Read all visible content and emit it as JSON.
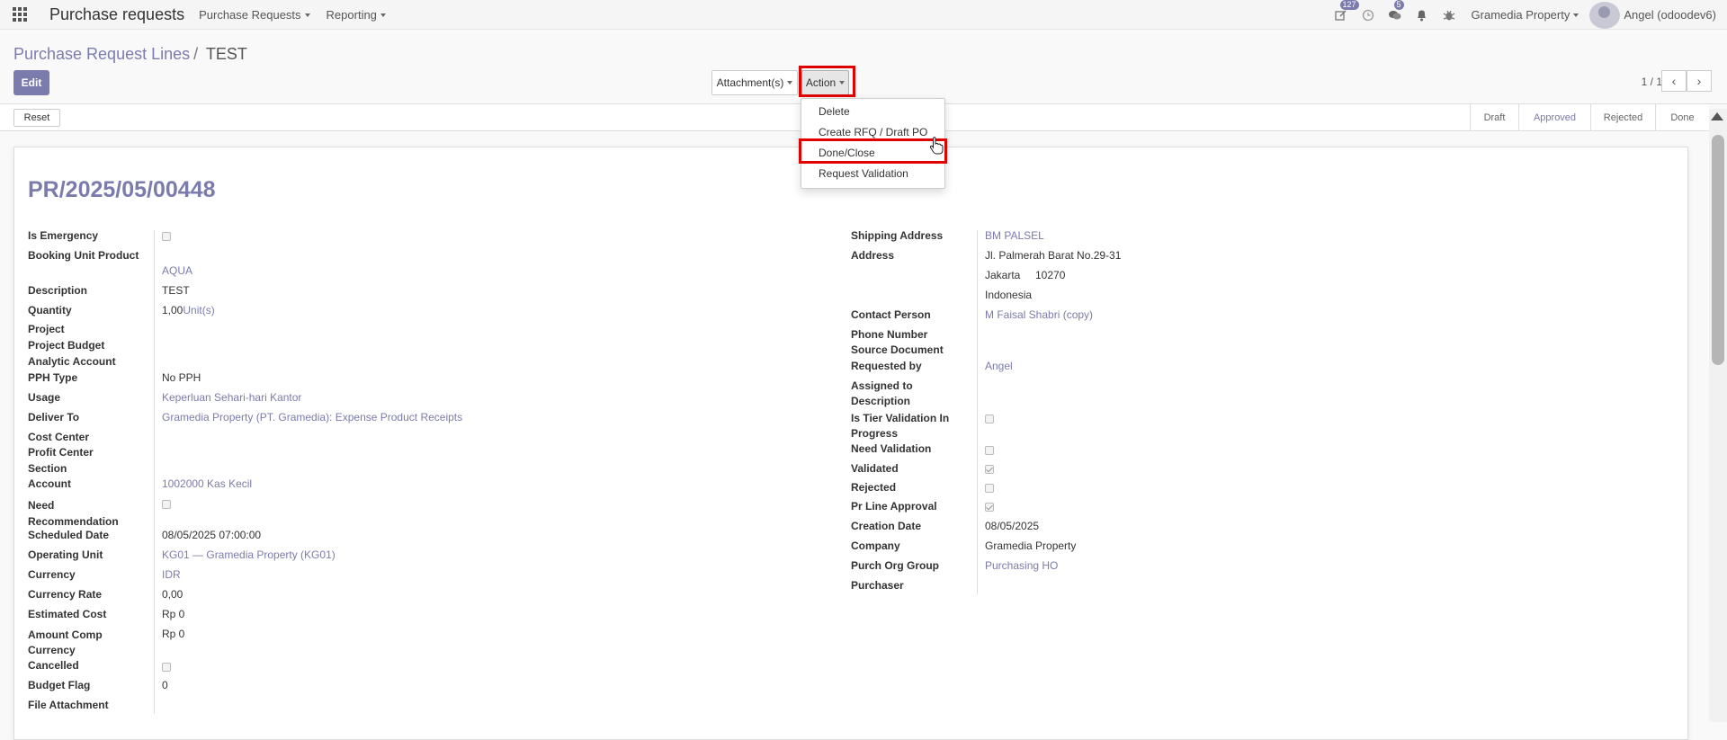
{
  "navbar": {
    "app_title": "Purchase requests",
    "menus": [
      "Purchase Requests",
      "Reporting"
    ],
    "activity_badge": "127",
    "chat_badge": "5",
    "company": "Gramedia Property",
    "user": "Angel (odoodev6)"
  },
  "breadcrumb": {
    "parent": "Purchase Request Lines",
    "current": "TEST"
  },
  "toolbar": {
    "edit": "Edit",
    "attachments": "Attachment(s)",
    "action": "Action",
    "pager": "1 / 1"
  },
  "statusbar": {
    "reset": "Reset",
    "stages": [
      "Draft",
      "Approved",
      "Rejected",
      "Done"
    ]
  },
  "action_menu": [
    "Delete",
    "Create RFQ / Draft PO",
    "Done/Close",
    "Request Validation"
  ],
  "record": {
    "name": "PR/2025/05/00448",
    "left": {
      "is_emergency": "Is Emergency",
      "booking_unit_product": "Booking Unit Product",
      "booking_unit_product_value": "AQUA",
      "description": "Description",
      "description_value": "TEST",
      "quantity": "Quantity",
      "quantity_value": "1,00",
      "quantity_uom": "Unit(s)",
      "project": "Project",
      "project_budget": "Project Budget",
      "analytic_account": "Analytic Account",
      "pph_type": "PPH Type",
      "pph_type_value": "No PPH",
      "usage": "Usage",
      "usage_value": "Keperluan Sehari-hari Kantor",
      "deliver_to": "Deliver To",
      "deliver_to_value": "Gramedia Property (PT. Gramedia): Expense Product Receipts",
      "cost_center": "Cost Center",
      "profit_center": "Profit Center",
      "section": "Section",
      "account": "Account",
      "account_value": "1002000 Kas Kecil",
      "need_recommendation": "Need Recommendation",
      "scheduled_date": "Scheduled Date",
      "scheduled_date_value": "08/05/2025 07:00:00",
      "operating_unit": "Operating Unit",
      "operating_unit_value": "KG01 — Gramedia Property (KG01)",
      "currency": "Currency",
      "currency_value": "IDR",
      "currency_rate": "Currency Rate",
      "currency_rate_value": "0,00",
      "estimated_cost": "Estimated Cost",
      "estimated_cost_value": "Rp 0",
      "amount_comp_currency": "Amount Comp Currency",
      "amount_comp_currency_value": "Rp 0",
      "cancelled": "Cancelled",
      "budget_flag": "Budget Flag",
      "budget_flag_value": "0",
      "file_attachment": "File Attachment"
    },
    "right": {
      "shipping_address": "Shipping Address",
      "shipping_address_value": "BM PALSEL",
      "address": "Address",
      "address_line1": "Jl. Palmerah Barat No.29-31",
      "address_city": "Jakarta",
      "address_zip": "10270",
      "address_country": "Indonesia",
      "contact_person": "Contact Person",
      "contact_person_value": "M Faisal Shabri (copy)",
      "phone_number": "Phone Number",
      "source_document": "Source Document",
      "requested_by": "Requested by",
      "requested_by_value": "Angel",
      "assigned_to": "Assigned to",
      "description": "Description",
      "is_tier_validation": "Is Tier Validation In Progress",
      "need_validation": "Need Validation",
      "validated": "Validated",
      "rejected": "Rejected",
      "pr_line_approval": "Pr Line Approval",
      "creation_date": "Creation Date",
      "creation_date_value": "08/05/2025",
      "company": "Company",
      "company_value": "Gramedia Property",
      "purch_org_group": "Purch Org Group",
      "purch_org_group_value": "Purchasing HO",
      "purchaser": "Purchaser"
    }
  }
}
